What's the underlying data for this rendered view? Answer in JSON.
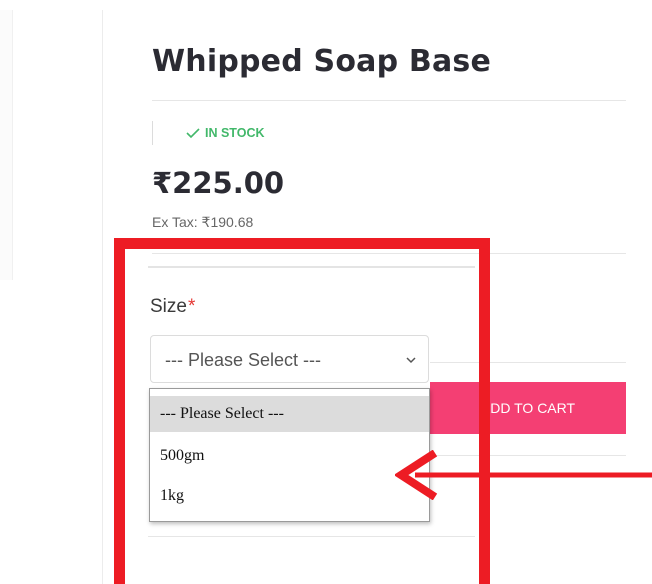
{
  "product": {
    "title": "Whipped Soap Base",
    "stock_status": "IN STOCK",
    "price": "₹225.00",
    "ex_tax": "Ex Tax: ₹190.68"
  },
  "options": {
    "size_label": "Size",
    "required_mark": "*",
    "selected": "--- Please Select ---",
    "dropdown_items": [
      "--- Please Select ---",
      "500gm",
      "1kg"
    ]
  },
  "actions": {
    "add_to_cart": "ADD TO CART"
  },
  "colors": {
    "accent": "#f43f73",
    "stock_green": "#42b86a",
    "annotation_red": "#ed1c24"
  },
  "icons": {
    "stock": "check-icon",
    "select": "chevron-down-icon",
    "annotation": "arrow-left-icon"
  }
}
